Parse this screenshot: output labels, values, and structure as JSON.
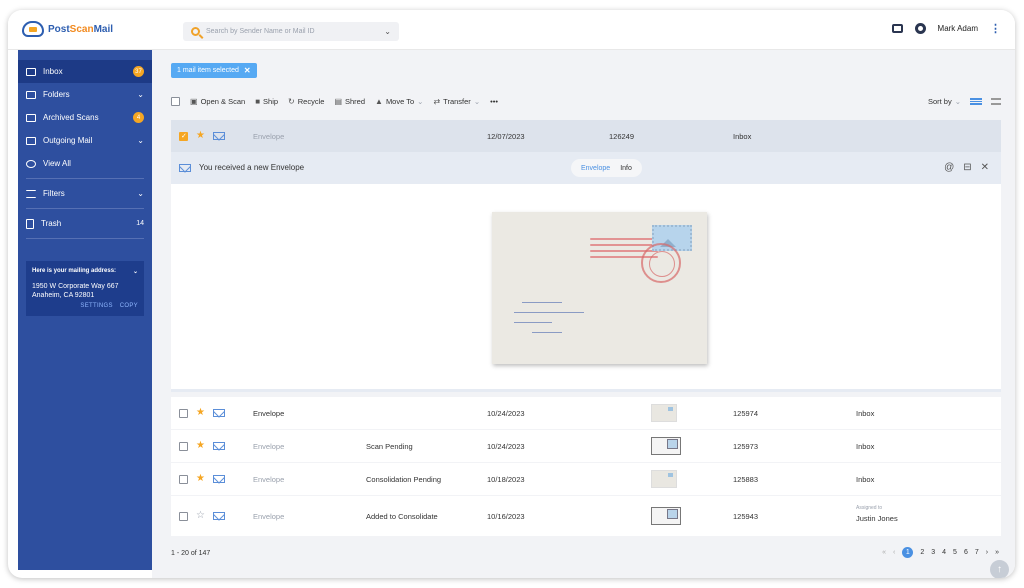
{
  "app": {
    "logo_prefix": "Post",
    "logo_accent": "Scan",
    "logo_suffix": "Mail"
  },
  "search": {
    "placeholder": "Search by Sender Name or Mail ID"
  },
  "user": {
    "name": "Mark Adam"
  },
  "sidebar": {
    "items": [
      {
        "label": "Inbox",
        "badge": "37",
        "icon": "inbox-icon"
      },
      {
        "label": "Folders",
        "icon": "folder-icon"
      },
      {
        "label": "Archived Scans",
        "badge": "4",
        "icon": "archive-icon"
      },
      {
        "label": "Outgoing Mail",
        "icon": "outgoing-icon"
      },
      {
        "label": "View All",
        "icon": "eye-icon"
      },
      {
        "label": "Filters",
        "icon": "filter-icon"
      },
      {
        "label": "Trash",
        "count": "14",
        "icon": "trash-icon"
      }
    ],
    "address": {
      "heading": "Here is your mailing address:",
      "line1": "1950 W Corporate Way 667",
      "line2": "Anaheim, CA 92801",
      "settings": "SETTINGS",
      "copy": "COPY"
    }
  },
  "selection_chip": {
    "label": "1 mail item selected"
  },
  "toolbar": {
    "open_scan": "Open & Scan",
    "ship": "Ship",
    "recycle": "Recycle",
    "shred": "Shred",
    "move_to": "Move To",
    "transfer": "Transfer",
    "more": "•••",
    "sort_by": "Sort by"
  },
  "selected_row": {
    "type": "Envelope",
    "date": "12/07/2023",
    "id": "126249",
    "folder": "Inbox"
  },
  "detail": {
    "title": "You received a new Envelope",
    "tab_envelope": "Envelope",
    "tab_info": "Info"
  },
  "rows": [
    {
      "type": "Envelope",
      "status": "",
      "date": "10/24/2023",
      "id": "125974",
      "folder": "Inbox",
      "starred": true
    },
    {
      "type": "Envelope",
      "status": "Scan Pending",
      "date": "10/24/2023",
      "id": "125973",
      "folder": "Inbox",
      "starred": true
    },
    {
      "type": "Envelope",
      "status": "Consolidation Pending",
      "date": "10/18/2023",
      "id": "125883",
      "folder": "Inbox",
      "starred": true
    },
    {
      "type": "Envelope",
      "status": "Added to Consolidate",
      "date": "10/16/2023",
      "id": "125943",
      "assigned_label": "Assigned to",
      "assigned_to": "Justin Jones",
      "starred": false
    }
  ],
  "pagination": {
    "range": "1 - 20 of 147",
    "pages": [
      "1",
      "2",
      "3",
      "4",
      "5",
      "6",
      "7"
    ],
    "current": "1"
  },
  "colors": {
    "sidebar": "#2e4f9f",
    "accent": "#4a90e2",
    "badge": "#f5a623"
  }
}
